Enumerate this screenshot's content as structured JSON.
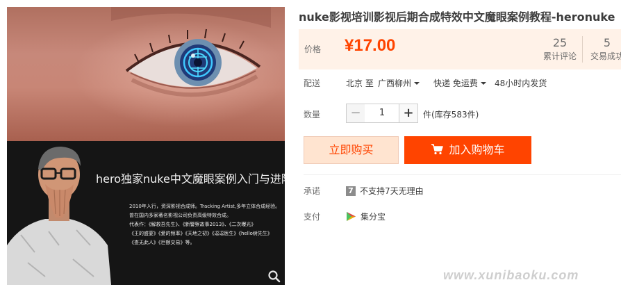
{
  "product": {
    "title": "nuke影视培训影视后期合成特效中文魔眼案例教程-heronuke"
  },
  "gallery": {
    "promo_title": "hero独家nuke中文魔眼案例入门与进阶",
    "promo_lines": [
      "2010年入行，资深影视合成师。Tracking Artist,多年立体合成经验。",
      "曾在国内多家著名影视公司负责高级特效合成。",
      "代表作：《解救吾先生》、《新警察故事2013》、《二次曝光》",
      "《王的盛宴》《爱的频率》《天地之初》《逗逗医生》《hello树先生》",
      "《查无此人》《巨额交易》等。"
    ],
    "zoom_icon": "search-icon"
  },
  "price": {
    "label": "价格",
    "value": "¥17.00",
    "reviews_count": "25",
    "reviews_label": "累计评论",
    "trades_count": "5",
    "trades_label": "交易成功"
  },
  "shipping": {
    "label": "配送",
    "from": "北京 至",
    "to": "广西柳州",
    "method": "快递 免运费",
    "dispatch": "48小时内发货"
  },
  "quantity": {
    "label": "数量",
    "minus": "−",
    "value": "1",
    "plus": "+",
    "stock": "件(库存583件)"
  },
  "actions": {
    "buy_now": "立即购买",
    "add_to_cart": "加入购物车"
  },
  "promise": {
    "label": "承诺",
    "icon_text": "7",
    "text": "不支持7天无理由"
  },
  "payment": {
    "label": "支付",
    "method": "集分宝"
  },
  "watermark": "www.xunibaoku.com",
  "colors": {
    "accent": "#ff4400",
    "price_bg": "#fff2e8",
    "buy_bg": "#ffe4d0"
  }
}
